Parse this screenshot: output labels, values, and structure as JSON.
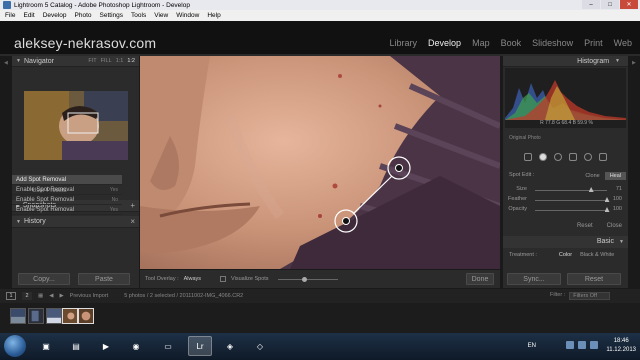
{
  "window": {
    "title": "Lightroom 5 Catalog - Adobe Photoshop Lightroom - Develop",
    "min": "–",
    "max": "□",
    "close": "✕"
  },
  "menu": [
    "File",
    "Edit",
    "Develop",
    "Photo",
    "Settings",
    "Tools",
    "View",
    "Window",
    "Help"
  ],
  "identity": {
    "brand": "aleksey-nekrasov.com",
    "modules": [
      "Library",
      "Develop",
      "Map",
      "Book",
      "Slideshow",
      "Print",
      "Web"
    ],
    "active_module": "Develop"
  },
  "left": {
    "navigator": {
      "title": "Navigator",
      "options": [
        "FIT",
        "FILL",
        "1:1",
        "1:2"
      ],
      "selected": "1:2"
    },
    "presets_label": "User Presets",
    "snapshots": {
      "title": "Snapshots",
      "add": "+"
    },
    "history": {
      "title": "History",
      "clear": "×",
      "items": [
        {
          "label": "Add Spot Removal",
          "extra": ""
        },
        {
          "label": "Enable Spot Removal",
          "extra": "Yes"
        },
        {
          "label": "Enable Spot Removal",
          "extra": "No"
        },
        {
          "label": "Enable Spot Removal",
          "extra": "Yes"
        }
      ]
    },
    "copy_btn": "Copy...",
    "paste_btn": "Paste"
  },
  "toolbar": {
    "overlay_label": "Tool Overlay :",
    "overlay_value": "Always",
    "visualize_label": "Visualize Spots",
    "done": "Done"
  },
  "right": {
    "histogram_title": "Histogram",
    "rgb_readout": "R  77.8  G  68.4  B  59.9 %",
    "original_photo": "Original Photo",
    "spot_edit_label": "Spot Edit :",
    "modes": [
      "Clone",
      "Heal"
    ],
    "selected_mode": "Heal",
    "sliders": [
      {
        "label": "Size",
        "value": "71",
        "pos": 0.78
      },
      {
        "label": "Feather",
        "value": "100",
        "pos": 1.0
      },
      {
        "label": "Opacity",
        "value": "100",
        "pos": 1.0
      }
    ],
    "reset": "Reset",
    "close": "Close",
    "basic_title": "Basic",
    "treatment_label": "Treatment :",
    "treatment_options": [
      "Color",
      "Black & White"
    ],
    "treatment_selected": "Color",
    "sync_btn": "Sync...",
    "reset_btn": "Reset"
  },
  "filmbar": {
    "screen1": "1",
    "screen2": "2",
    "source": "Previous Import",
    "count": "5 photos / 2 selected / 20111002-IMG_4066.CR2",
    "filter_label": "Filter :",
    "filter_value": "Filters Off"
  },
  "taskbar": {
    "lang": "EN",
    "time": "18:46",
    "date": "11.12.2013",
    "apps": [
      "explorer",
      "files",
      "media",
      "chrome",
      "document",
      "Lr",
      "tool",
      "tool2"
    ]
  },
  "colors": {
    "accent": "#e8e8e8",
    "panel": "#2b2b2b",
    "skin": "#c8977e"
  }
}
